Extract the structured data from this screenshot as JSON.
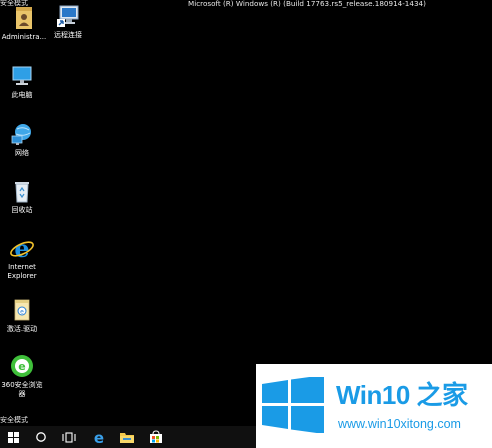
{
  "desktop": {
    "safe_mode_top": "安全模式",
    "safe_mode_bottom": "安全模式",
    "build_info": "Microsoft (R) Windows (R) (Build 17763.rs5_release.180914-1434)",
    "icons": [
      {
        "label": "Administra...",
        "icon": "folder-user-icon"
      },
      {
        "label": "远程连接",
        "icon": "remote-desktop-icon"
      },
      {
        "label": "此电脑",
        "icon": "computer-icon"
      },
      {
        "label": "网络",
        "icon": "network-icon"
      },
      {
        "label": "回收站",
        "icon": "recycle-bin-icon"
      },
      {
        "label": "Internet Explorer",
        "icon": "ie-icon"
      },
      {
        "label": "激活.驱动",
        "icon": "document-icon"
      },
      {
        "label": "360安全浏览器",
        "icon": "360-browser-icon"
      }
    ]
  },
  "taskbar": {
    "items": [
      {
        "name": "start",
        "icon": "windows-icon"
      },
      {
        "name": "search",
        "icon": "search-icon"
      },
      {
        "name": "task-view",
        "icon": "task-view-icon"
      },
      {
        "name": "edge",
        "icon": "edge-icon"
      },
      {
        "name": "file-explorer",
        "icon": "folder-icon"
      },
      {
        "name": "store",
        "icon": "store-icon"
      }
    ]
  },
  "watermark": {
    "title": "Win10 之家",
    "url": "www.win10xitong.com",
    "accent": "#1a9be6"
  }
}
